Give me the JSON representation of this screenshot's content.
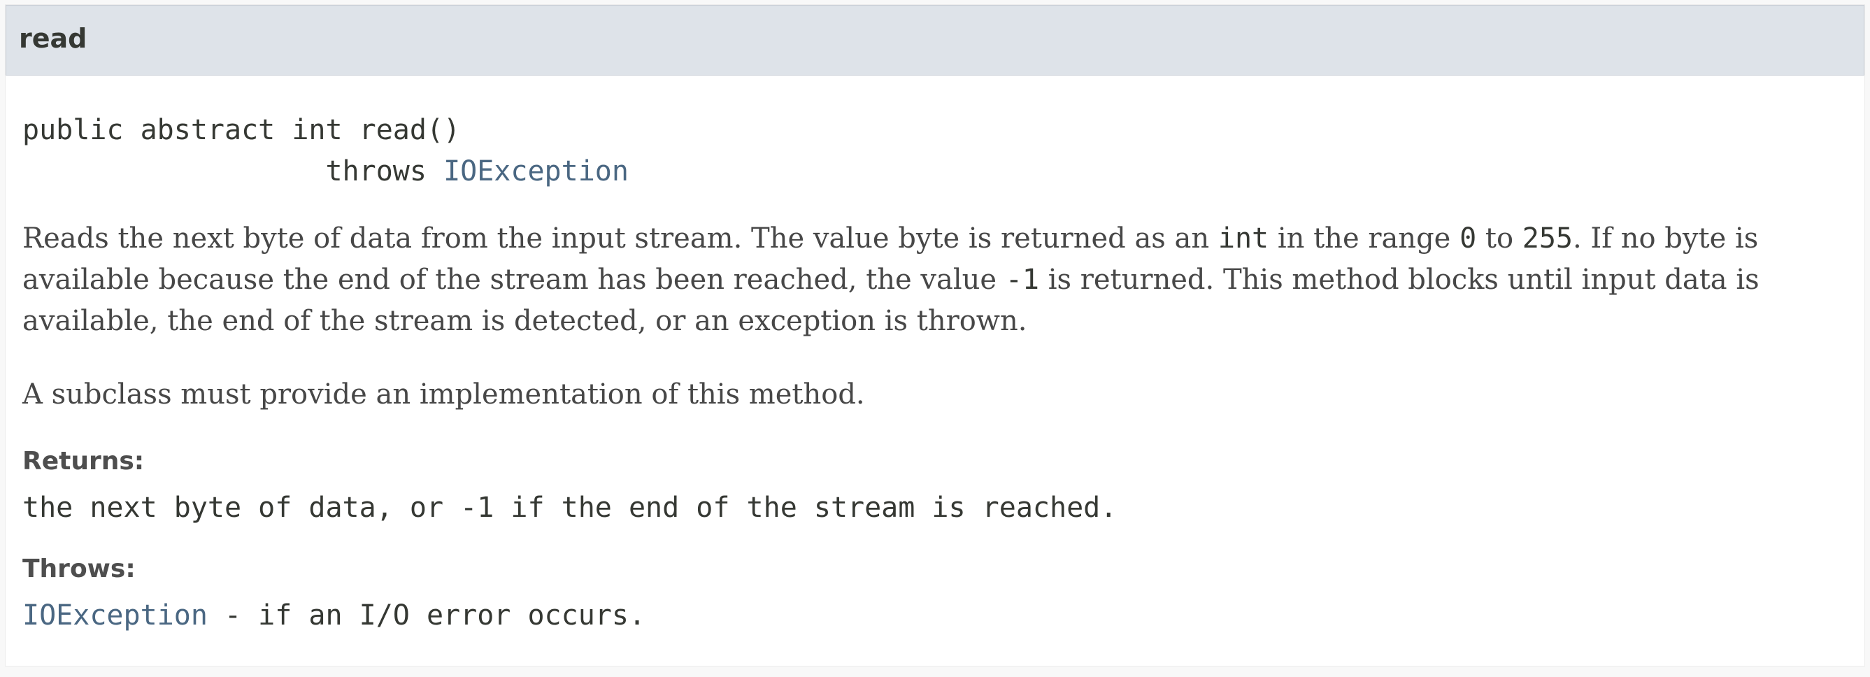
{
  "method": {
    "name": "read",
    "signature": {
      "line1": "public abstract int read()",
      "throws_prefix": "                  throws ",
      "throws_type": "IOException"
    },
    "description": {
      "p1_a": "Reads the next byte of data from the input stream. The value byte is returned as an ",
      "p1_code1": "int",
      "p1_b": " in the range ",
      "p1_code2": "0",
      "p1_c": " to ",
      "p1_code3": "255",
      "p1_d": ". If no byte is available because the end of the stream has been reached, the value ",
      "p1_code4": "-1",
      "p1_e": " is returned. This method blocks until input data is available, the end of the stream is detected, or an exception is thrown.",
      "p2": "A subclass must provide an implementation of this method."
    },
    "returns": {
      "label": "Returns:",
      "text": "the next byte of data, or -1 if the end of the stream is reached."
    },
    "throws": {
      "label": "Throws:",
      "type": "IOException",
      "text": " - if an I/O error occurs."
    }
  }
}
